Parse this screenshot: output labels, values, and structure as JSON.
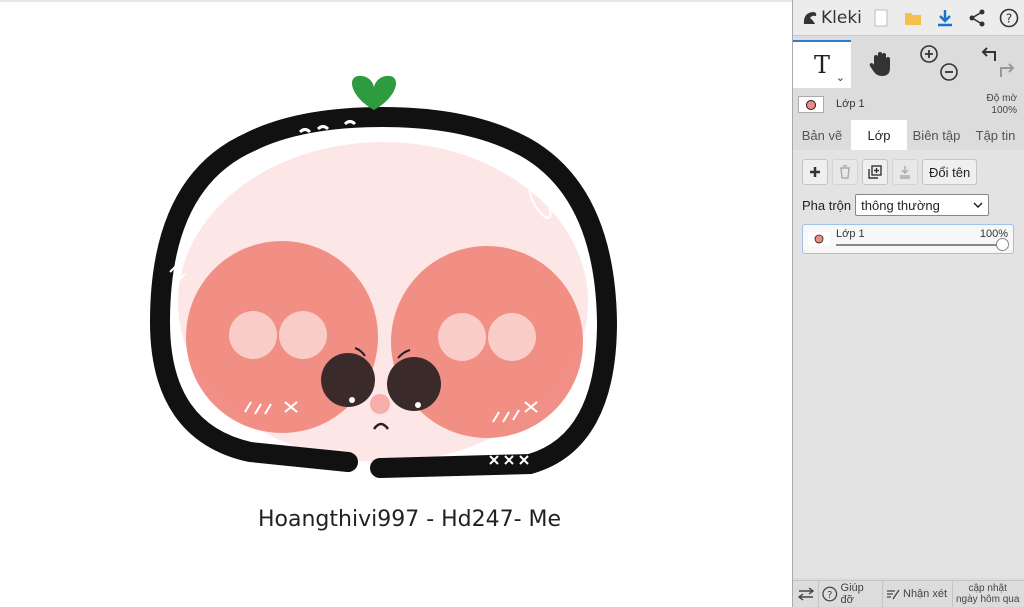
{
  "app": {
    "title": "Kleki"
  },
  "artwork": {
    "signature": "Hoangthivi997 - Hd247- Me"
  },
  "colors": {
    "accent": "#2b7bd3",
    "download": "#1a73c9",
    "folder": "#f2c14e",
    "leaf": "#2e9b3f",
    "cheek": "#f08a80"
  },
  "topbar": {
    "icons": [
      "kleki-logo-icon",
      "new-file-icon",
      "open-folder-icon",
      "download-icon",
      "share-icon",
      "help-icon"
    ]
  },
  "tools": {
    "active": "text",
    "items": [
      "text-tool-icon",
      "hand-tool-icon",
      "zoom-in-icon",
      "zoom-out-icon",
      "undo-icon",
      "redo-icon"
    ]
  },
  "layer_strip": {
    "name": "Lớp 1",
    "opacity_label": "Độ mờ",
    "opacity_value": "100%"
  },
  "tabs": [
    {
      "label": "Bản vẽ"
    },
    {
      "label": "Lớp",
      "active": true
    },
    {
      "label": "Biên tập"
    },
    {
      "label": "Tập tin"
    }
  ],
  "layer_panel": {
    "rename_label": "Đổi tên",
    "blend_label": "Pha trộn",
    "blend_value": "thông thường",
    "layers": [
      {
        "name": "Lớp 1",
        "opacity": "100%",
        "opacity_fraction": 1.0
      }
    ]
  },
  "footer": {
    "help_label": "Giúp đỡ",
    "feedback_label": "Nhận xét",
    "update_line1": "cập nhật",
    "update_line2": "ngày hôm qua"
  }
}
